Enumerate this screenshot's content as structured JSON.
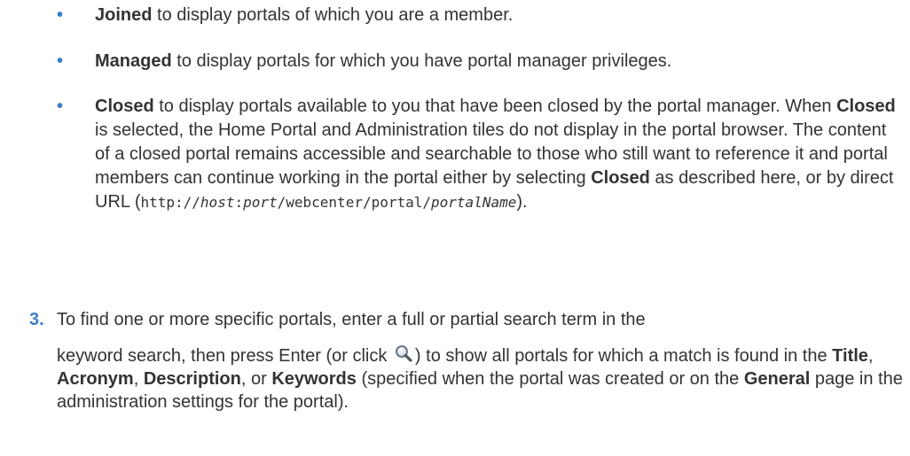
{
  "bullets": [
    {
      "term": "Joined",
      "text": " to display portals of which you are a member."
    },
    {
      "term": "Managed",
      "text": " to display portals for which you have portal manager privileges."
    },
    {
      "term": "Closed",
      "text_1": " to display portals available to you that have been closed by the portal manager. When ",
      "term_2": "Closed",
      "text_2": " is selected, the Home Portal and Administration tiles do not display in the portal browser. The content of a closed portal remains accessible and searchable to those who still want to reference it and portal members can continue working in the portal either by selecting ",
      "term_3": "Closed",
      "text_3": " as described here, or by direct URL (",
      "url_1": "http://",
      "url_host": "host",
      "url_2": ":",
      "url_port": "port",
      "url_3": "/webcenter/portal/",
      "url_name": "portalName",
      "text_4": ")."
    }
  ],
  "bullet_symbol": "•",
  "step": {
    "number": "3.",
    "line1": "To find one or more specific portals, enter a full or partial search term in the",
    "body_1": "keyword search, then press Enter (or click ",
    "icon": "search-icon",
    "body_2": ") to show all portals for which a match is found in the ",
    "term_title": "Title",
    "sep_1": ", ",
    "term_acronym": "Acronym",
    "sep_2": ", ",
    "term_description": "Description",
    "sep_3": ", or ",
    "term_keywords": "Keywords",
    "body_3": " (specified when the portal was created or on the ",
    "term_general": "General",
    "body_4": " page in the administration settings for the portal)."
  },
  "colors": {
    "accent": "#3b7ec6",
    "text": "#333333"
  }
}
